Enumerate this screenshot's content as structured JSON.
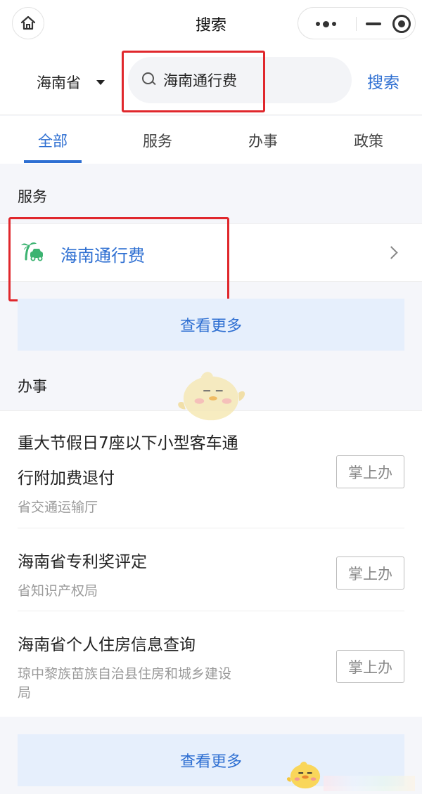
{
  "header": {
    "title": "搜索"
  },
  "search": {
    "region": "海南省",
    "query": "海南通行费",
    "submit_label": "搜索"
  },
  "tabs": [
    {
      "label": "全部"
    },
    {
      "label": "服务"
    },
    {
      "label": "办事"
    },
    {
      "label": "政策"
    }
  ],
  "services": {
    "section_title": "服务",
    "items": [
      {
        "name": "海南通行费",
        "icon": "palm-car-logo-icon"
      }
    ],
    "more_label": "查看更多"
  },
  "affairs": {
    "section_title": "办事",
    "items": [
      {
        "title_line1": "重大节假日7座以下小型客车通",
        "title_line2": "行附加费退付",
        "dept": "省交通运输厅",
        "action": "掌上办"
      },
      {
        "title_line1": "海南省专利奖评定",
        "title_line2": "",
        "dept": "省知识产权局",
        "action": "掌上办"
      },
      {
        "title_line1": "海南省个人住房信息查询",
        "title_line2": "",
        "dept_line1": "琼中黎族苗族自治县住房和城乡建设",
        "dept_line2": "局",
        "action": "掌上办"
      }
    ],
    "more_label": "查看更多"
  },
  "colors": {
    "accent": "#2e6fd2",
    "highlight_box": "#e0272c",
    "more_button_bg": "#e6effc",
    "logo_green": "#3cb371"
  }
}
